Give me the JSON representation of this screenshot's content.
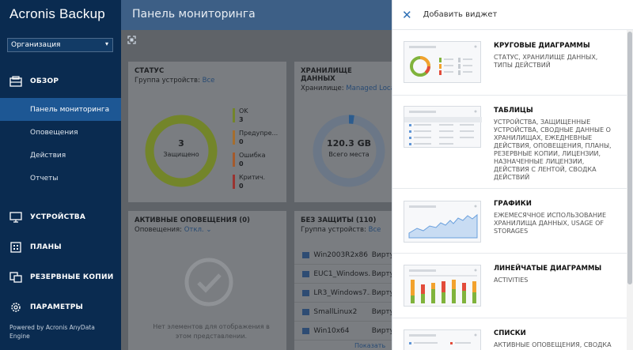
{
  "app": {
    "logo": "Acronis Backup",
    "org": "Организация"
  },
  "sidebar": {
    "overview": "ОБЗОР",
    "items": [
      "Панель мониторинга",
      "Оповещения",
      "Действия",
      "Отчеты"
    ],
    "devices": "УСТРОЙСТВА",
    "plans": "ПЛАНЫ",
    "backups": "РЕЗЕРВНЫЕ КОПИИ",
    "settings": "ПАРАМЕТРЫ",
    "powered": "Powered by Acronis AnyData Engine"
  },
  "main": {
    "title": "Панель мониторинга",
    "status": {
      "title": "СТАТУС",
      "sub_label": "Группа устройств:",
      "sub_value": "Все",
      "center_value": "3",
      "center_label": "Защищено",
      "legend": [
        {
          "label": "OK",
          "value": "3",
          "color": "#8faa28"
        },
        {
          "label": "Предупре...",
          "value": "0",
          "color": "#d8912a"
        },
        {
          "label": "Ошибка",
          "value": "0",
          "color": "#d8702a"
        },
        {
          "label": "Критич.",
          "value": "0",
          "color": "#c7322b"
        }
      ]
    },
    "storage": {
      "title": "ХРАНИЛИЩЕ ДАННЫХ",
      "sub_label": "Хранилище:",
      "sub_value": "Managed Locat",
      "center_value": "120.3 GB",
      "center_label": "Всего места"
    },
    "alerts": {
      "title": "АКТИВНЫЕ ОПОВЕЩЕНИЯ (0)",
      "sub_label": "Оповещения:",
      "sub_value": "Откл.",
      "empty": "Нет элементов для отображения в этом представлении."
    },
    "unprotected": {
      "title": "БЕЗ ЗАЩИТЫ (110)",
      "sub_label": "Группа устройств:",
      "sub_value": "Все",
      "rows": [
        "Win2003R2x86 ...",
        "EUC1_Windows...",
        "LR3_Windows7...",
        "SmallLinux2",
        "Win10x64"
      ],
      "type": "Вирту",
      "show_all": "Показать во..."
    }
  },
  "panel": {
    "title": "Добавить виджет",
    "widgets": [
      {
        "title": "КРУГОВЫЕ ДИАГРАММЫ",
        "desc": "СТАТУС, ХРАНИЛИЩЕ ДАННЫХ, ТИПЫ ДЕЙСТВИЙ"
      },
      {
        "title": "ТАБЛИЦЫ",
        "desc": "УСТРОЙСТВА, ЗАЩИЩЕННЫЕ УСТРОЙСТВА, СВОДНЫЕ ДАННЫЕ О ХРАНИЛИЩАХ, ЕЖЕДНЕВНЫЕ ДЕЙСТВИЯ, ОПОВЕЩЕНИЯ, ПЛАНЫ, РЕЗЕРВНЫЕ КОПИИ, ЛИЦЕНЗИИ, НАЗНАЧЕННЫЕ ЛИЦЕНЗИИ, ДЕЙСТВИЯ С ЛЕНТОЙ, СВОДКА ДЕЙСТВИЙ"
      },
      {
        "title": "ГРАФИКИ",
        "desc": "ЕЖЕМЕСЯЧНОЕ ИСПОЛЬЗОВАНИЕ ХРАНИЛИЩА ДАННЫХ, USAGE OF STORAGES"
      },
      {
        "title": "ЛИНЕЙЧАТЫЕ ДИАГРАММЫ",
        "desc": "ACTIVITIES"
      },
      {
        "title": "СПИСКИ",
        "desc": "АКТИВНЫЕ ОПОВЕЩЕНИЯ, СВОДКА"
      }
    ]
  }
}
